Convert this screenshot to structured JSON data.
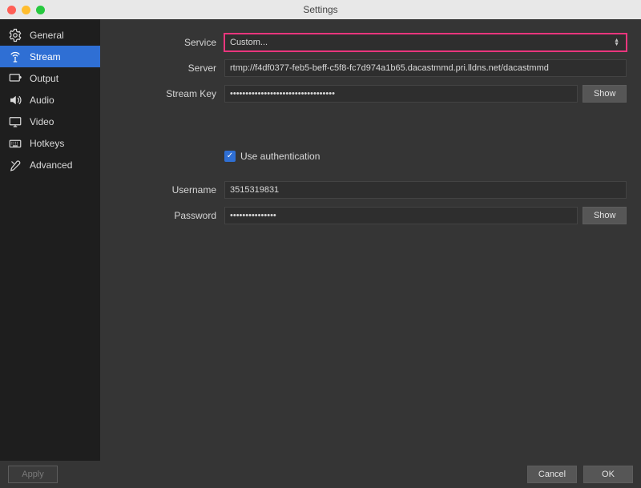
{
  "window": {
    "title": "Settings"
  },
  "sidebar": {
    "items": [
      {
        "label": "General"
      },
      {
        "label": "Stream"
      },
      {
        "label": "Output"
      },
      {
        "label": "Audio"
      },
      {
        "label": "Video"
      },
      {
        "label": "Hotkeys"
      },
      {
        "label": "Advanced"
      }
    ],
    "active_index": 1
  },
  "form": {
    "service_label": "Service",
    "service_value": "Custom...",
    "server_label": "Server",
    "server_value": "rtmp://f4df0377-feb5-beff-c5f8-fc7d974a1b65.dacastmmd.pri.lldns.net/dacastmmd",
    "streamkey_label": "Stream Key",
    "streamkey_value": "••••••••••••••••••••••••••••••••••",
    "show_label": "Show",
    "auth_checkbox_label": "Use authentication",
    "auth_checked": true,
    "username_label": "Username",
    "username_value": "3515319831",
    "password_label": "Password",
    "password_value": "•••••••••••••••"
  },
  "footer": {
    "apply": "Apply",
    "cancel": "Cancel",
    "ok": "OK"
  }
}
